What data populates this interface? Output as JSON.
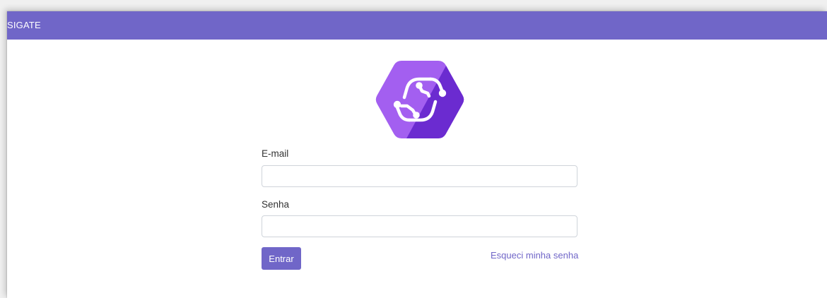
{
  "app": {
    "title": "SIGATE"
  },
  "login": {
    "email_label": "E-mail",
    "email_value": "",
    "password_label": "Senha",
    "password_value": "",
    "submit_label": "Entrar",
    "forgot_label": "Esqueci minha senha"
  },
  "icons": {
    "logo": "hexagon-circuit-s-logo-icon"
  },
  "colors": {
    "primary": "#7066c8",
    "logo_light": "#a35ff0",
    "logo_dark": "#6b2bd0",
    "text": "#333333",
    "input_border": "#cfd4da"
  }
}
